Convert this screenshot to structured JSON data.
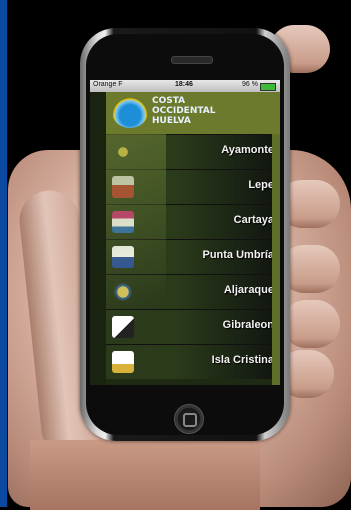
{
  "status_bar": {
    "carrier": "Orange F",
    "time": "18:46",
    "battery": "96 %"
  },
  "header": {
    "logo_line1": "COSTA",
    "logo_line2": "OCCIDENTAL",
    "logo_line3": "HUELVA"
  },
  "towns": [
    {
      "label": "Ayamonte",
      "icon": "coat-of-arms-ayamonte-icon"
    },
    {
      "label": "Lepe",
      "icon": "coat-of-arms-lepe-icon"
    },
    {
      "label": "Cartaya",
      "icon": "coat-of-arms-cartaya-icon"
    },
    {
      "label": "Punta Umbría",
      "icon": "coat-of-arms-punta-umbria-icon"
    },
    {
      "label": "Aljaraque",
      "icon": "coat-of-arms-aljaraque-icon"
    },
    {
      "label": "Gibraleon",
      "icon": "coat-of-arms-gibraleon-icon"
    },
    {
      "label": "Isla Cristina",
      "icon": "coat-of-arms-isla-cristina-icon"
    }
  ],
  "colors": {
    "header_bg": "#6b7a2c",
    "list_bg": "#2c3a1c",
    "battery": "#3fb93a"
  }
}
